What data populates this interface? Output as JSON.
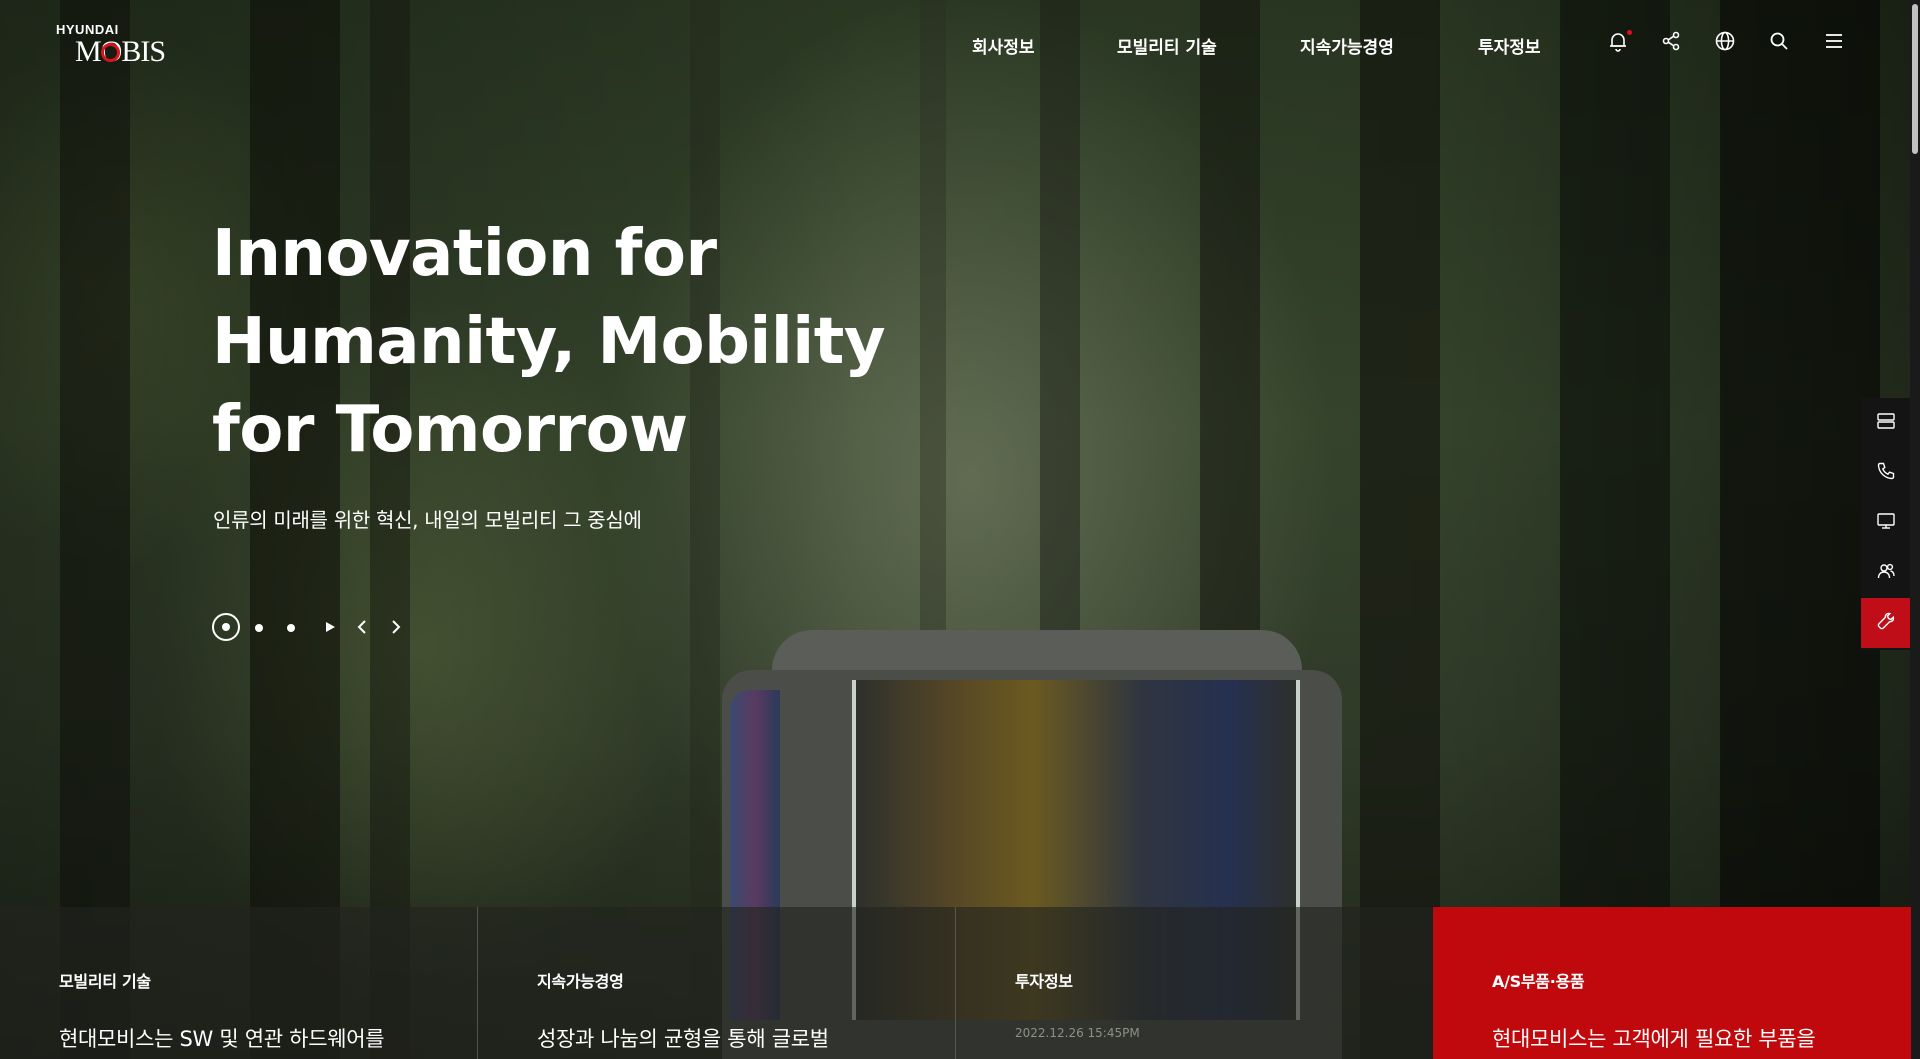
{
  "brand": {
    "logo_top": "HYUNDAI",
    "logo_main": "MOBIS",
    "accent_color": "#d8141c"
  },
  "nav": {
    "items": [
      "회사정보",
      "모빌리티 기술",
      "지속가능경영",
      "투자정보"
    ],
    "icons": [
      "bell-icon",
      "share-icon",
      "globe-icon",
      "search-icon",
      "menu-icon"
    ]
  },
  "hero": {
    "title_lines": [
      "Innovation for",
      "Humanity, Mobility",
      "for Tomorrow"
    ],
    "subtitle": "인류의 미래를 위한 혁신, 내일의 모빌리티 그 중심에",
    "slides_total": 3,
    "slide_active": 1
  },
  "quick_menu": {
    "icons": [
      "layout-icon",
      "phone-icon",
      "monitor-icon",
      "people-icon",
      "wrench-icon"
    ],
    "active_color": "#c00e18"
  },
  "cards": [
    {
      "title": "모빌리티 기술",
      "text": "현대모비스는 SW 및 연관 하드웨어를"
    },
    {
      "title": "지속가능경영",
      "text": "성장과 나눔의 균형을 통해 글로벌"
    },
    {
      "title": "투자정보",
      "date": "2022.12.26 15:45PM"
    },
    {
      "title": "A/S부품·용품",
      "text": "현대모비스는 고객에게 필요한 부품을",
      "color": "#c0090d"
    }
  ]
}
